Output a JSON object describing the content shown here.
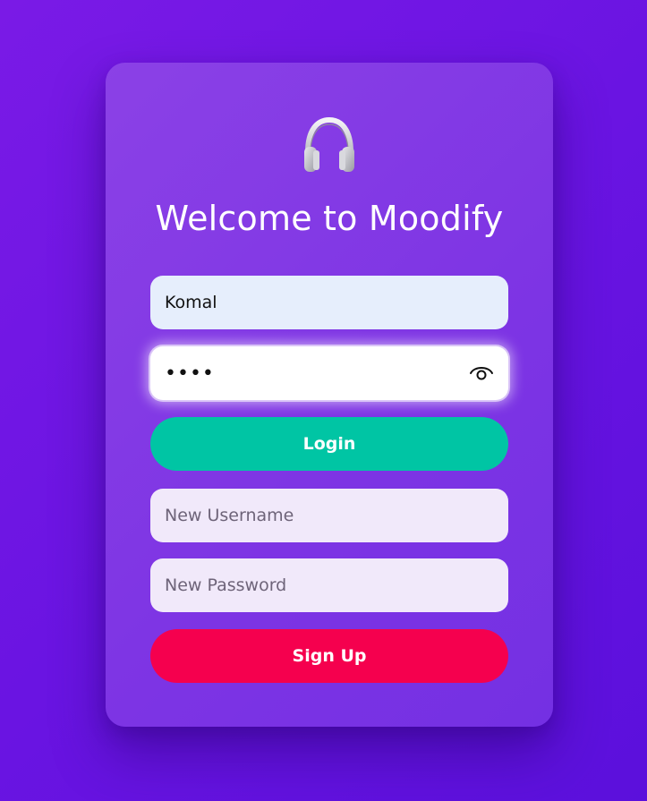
{
  "app": {
    "title": "Welcome to Moodify",
    "logo_icon": "headphones-icon"
  },
  "login": {
    "username_value": "Komal",
    "password_value": "••••",
    "password_toggle_icon": "eye-icon",
    "login_label": "Login"
  },
  "signup": {
    "new_username_placeholder": "New Username",
    "new_password_placeholder": "New Password",
    "signup_label": "Sign Up"
  },
  "colors": {
    "background": "#6a14e2",
    "card": "#8038e4",
    "login_button": "#00c5a4",
    "signup_button": "#f5004e",
    "text_light": "#ffffff"
  }
}
